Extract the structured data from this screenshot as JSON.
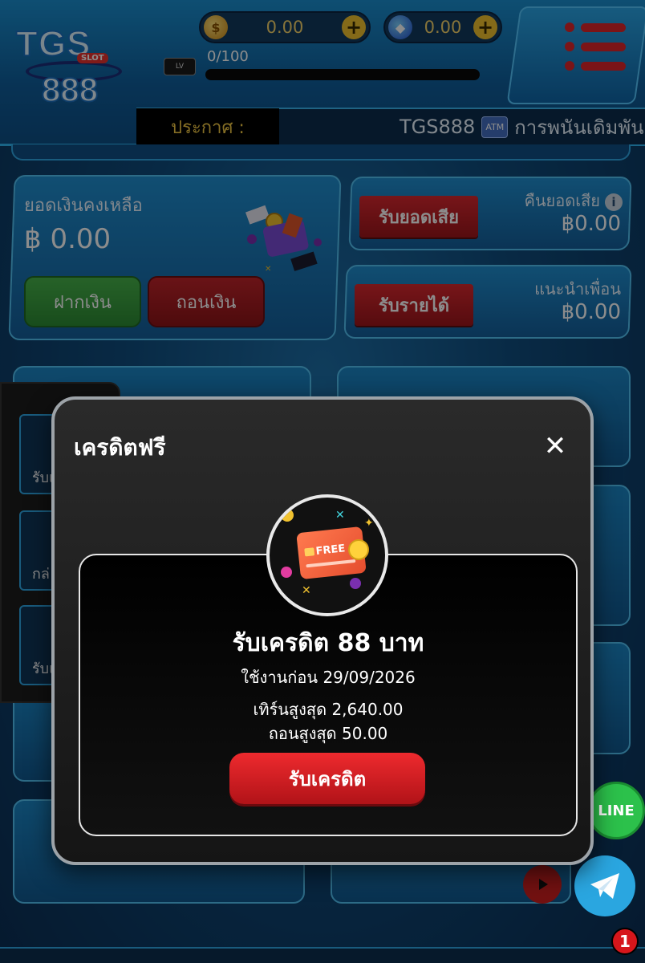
{
  "header": {
    "logo_text": "TGS",
    "logo_badge": "SLOT",
    "logo_number": "888",
    "coin_balance": "0.00",
    "gem_balance": "0.00",
    "level_progress_text": "0/100",
    "level_progress": 0
  },
  "announcement": {
    "label": "ประกาศ :",
    "ticker_text": "TGS888",
    "ticker_badge": "ATM",
    "ticker_rest": "การพนันเดิมพัน"
  },
  "balance": {
    "title": "ยอดเงินคงเหลือ",
    "value": "฿ 0.00",
    "deposit_label": "ฝากเงิน",
    "withdraw_label": "ถอนเงิน"
  },
  "cashback": {
    "button_label": "รับยอดเสีย",
    "title": "คืนยอดเสีย",
    "value": "฿0.00"
  },
  "referral": {
    "button_label": "รับรายได้",
    "title": "แนะนำเพื่อน",
    "value": "฿0.00"
  },
  "drawer": {
    "items": [
      "รับเ",
      "กล่",
      "รับแ"
    ]
  },
  "floating": {
    "line_label": "LINE",
    "notification_count": "1"
  },
  "modal": {
    "title": "เครดิตฟรี",
    "close_glyph": "✕",
    "badge_text": "FREE",
    "heading": "รับเครดิต 88 บาท",
    "expiry": "ใช้งานก่อน 29/09/2026",
    "max_turnover": "เทิร์นสูงสุด 2,640.00",
    "max_withdraw": "ถอนสูงสุด 50.00",
    "claim_label": "รับเครดิต"
  },
  "colors": {
    "accent_red": "#d9282f",
    "accent_green": "#2d8b34",
    "gold": "#f1c22f",
    "panel_blue": "#1f8ed0"
  }
}
